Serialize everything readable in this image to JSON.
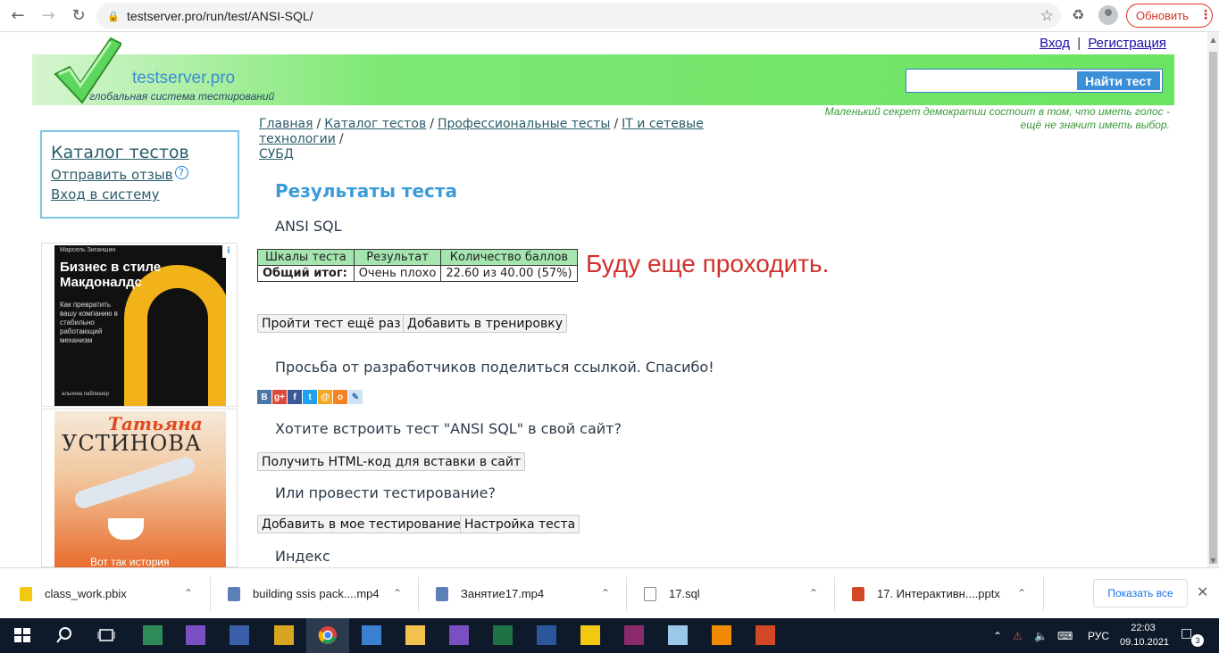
{
  "browser": {
    "url": "testserver.pro/run/test/ANSI-SQL/",
    "update_label": "Обновить"
  },
  "auth": {
    "login": "Вход",
    "separator": "|",
    "register": "Регистрация"
  },
  "header": {
    "site_name": "testserver.pro",
    "tagline": "глобальная система тестирований",
    "search_button": "Найти тест",
    "search_value": ""
  },
  "quote": "Маленький секрет демократии состоит в том, что иметь голос - ещё не значит иметь выбор.",
  "sidebar": {
    "catalog": "Каталог тестов",
    "feedback": "Отправить отзыв",
    "help_icon": "?",
    "login": "Вход в систему"
  },
  "ads": {
    "ad1": {
      "author": "Марсель Зиганшин",
      "title": "Бизнес в стиле Макдоналдс",
      "subtitle": "Как превратить вашу компанию в стабильно работающий механизм",
      "publisher": "альпина паблишер"
    },
    "ad2": {
      "author_first": "Татьяна",
      "author_last": "УСТИНОВА",
      "bottom": "Вот так история"
    }
  },
  "breadcrumb": {
    "items": [
      "Главная",
      "Каталог тестов",
      "Профессиональные тесты",
      "IT и сетевые технологии",
      "СУБД"
    ],
    "separator": "/"
  },
  "results": {
    "heading": "Результаты теста",
    "test_name": "ANSI SQL",
    "table": {
      "headers": [
        "Шкалы теста",
        "Результат",
        "Количество баллов"
      ],
      "row": [
        "Общий итог:",
        "Очень плохо",
        "22.60 из 40.00 (57%)"
      ]
    },
    "comment": "Буду еще проходить.",
    "retry_button": "Пройти тест ещё раз",
    "training_button": "Добавить в тренировку"
  },
  "share": {
    "text": "Просьба от разработчиков поделиться ссылкой. Спасибо!",
    "icons": [
      "vk-icon",
      "google-plus-icon",
      "facebook-icon",
      "twitter-icon",
      "mailru-icon",
      "odnoklassniki-icon",
      "livejournal-icon"
    ]
  },
  "embed": {
    "question": "Хотите встроить тест \"ANSI SQL\" в свой сайт?",
    "button": "Получить HTML-код для вставки в сайт"
  },
  "testing": {
    "question": "Или провести тестирование?",
    "add_button": "Добавить в мое тестирование",
    "settings_button": "Настройка теста"
  },
  "index_heading": "Индекс",
  "downloads": {
    "items": [
      "class_work.pbix",
      "building ssis pack....mp4",
      "Занятие17.mp4",
      "17.sql",
      "17. Интерактивн....pptx"
    ],
    "show_all": "Показать все"
  },
  "taskbar": {
    "language": "РУС",
    "time": "22:03",
    "date": "09.10.2021",
    "notifications": "3"
  }
}
